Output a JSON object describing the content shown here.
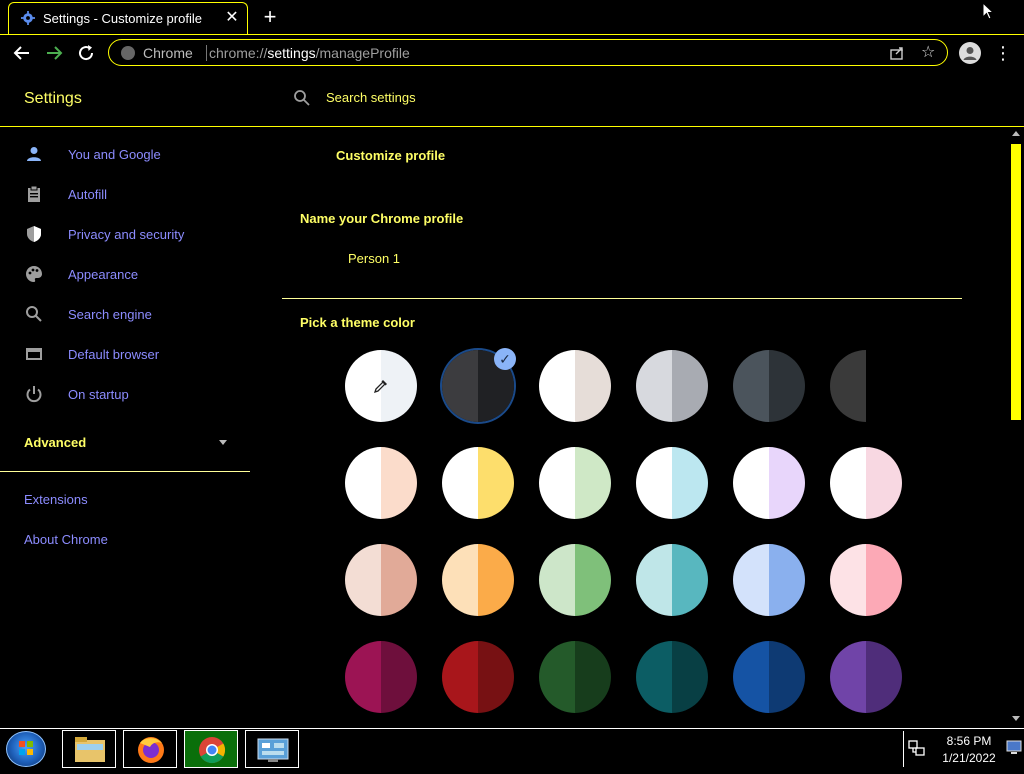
{
  "browser": {
    "tab_title": "Settings - Customize profile",
    "close_glyph": "✕",
    "newtab_glyph": "+",
    "omnibox_chip": "Chrome",
    "url_scheme": "chrome://",
    "url_host": "settings",
    "url_path": "/manageProfile",
    "star_glyph": "☆",
    "menu_glyph": "⋮"
  },
  "settings": {
    "title": "Settings",
    "search_placeholder": "Search settings"
  },
  "sidebar": {
    "items": [
      {
        "label": "You and Google",
        "icon": "person-icon"
      },
      {
        "label": "Autofill",
        "icon": "clipboard-icon"
      },
      {
        "label": "Privacy and security",
        "icon": "shield-icon"
      },
      {
        "label": "Appearance",
        "icon": "palette-icon"
      },
      {
        "label": "Search engine",
        "icon": "search-icon"
      },
      {
        "label": "Default browser",
        "icon": "browser-icon"
      },
      {
        "label": "On startup",
        "icon": "power-icon"
      }
    ],
    "advanced": "Advanced",
    "extensions": "Extensions",
    "about": "About Chrome"
  },
  "main": {
    "page_title": "Customize profile",
    "name_heading": "Name your Chrome profile",
    "name_value": "Person 1",
    "color_heading": "Pick a theme color",
    "selected_index": 1,
    "swatches": [
      [
        "#ffffff",
        "#eef2f6"
      ],
      [
        "#3c3c3f",
        "#202124"
      ],
      [
        "#ffffff",
        "#e6ddd8"
      ],
      [
        "#d7d9de",
        "#a8abb2"
      ],
      [
        "#4b545c",
        "#2d3338"
      ],
      [
        "#3a3a3a",
        "#1f1f1f"
      ],
      [
        "#ffffff",
        "#fbdccb"
      ],
      [
        "#ffffff",
        "#fdde6c"
      ],
      [
        "#ffffff",
        "#cfe8c6"
      ],
      [
        "#ffffff",
        "#bce7f0"
      ],
      [
        "#ffffff",
        "#e8d6fb"
      ],
      [
        "#ffffff",
        "#f8d8e2"
      ],
      [
        "#f3ddd4",
        "#e1aa98"
      ],
      [
        "#fde0b8",
        "#fbab49"
      ],
      [
        "#cde6c9",
        "#7fc07a"
      ],
      [
        "#bfe6e8",
        "#58b7bf"
      ],
      [
        "#d3e2fb",
        "#8ab0ee"
      ],
      [
        "#fde2e6",
        "#fca9b6"
      ],
      [
        "#9c1454",
        "#6e0f3c"
      ],
      [
        "#a8161b",
        "#771113"
      ],
      [
        "#245a2a",
        "#173d1c"
      ],
      [
        "#0c5d64",
        "#083f44"
      ],
      [
        "#1553a4",
        "#0e3a73"
      ],
      [
        "#7044a8",
        "#4f2d7a"
      ]
    ]
  },
  "taskbar": {
    "time": "8:56 PM",
    "date": "1/21/2022"
  },
  "colors": {
    "accent": "#ffff00",
    "heading": "#ffff66",
    "link": "#8c8cff"
  }
}
